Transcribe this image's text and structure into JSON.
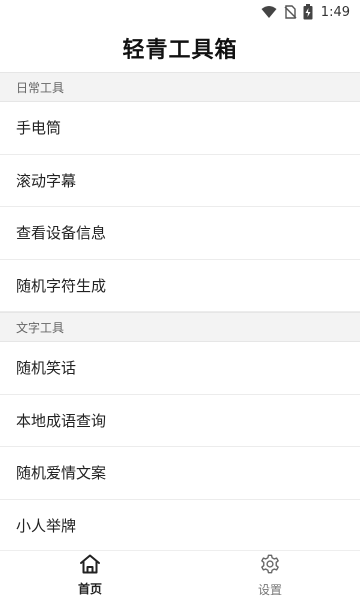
{
  "status_bar": {
    "time": "1:49",
    "icons": [
      "wifi-icon",
      "no-sim-icon",
      "battery-charging-icon"
    ]
  },
  "app_bar": {
    "title": "轻青工具箱"
  },
  "sections": [
    {
      "title": "日常工具",
      "items": [
        "手电筒",
        "滚动字幕",
        "查看设备信息",
        "随机字符生成"
      ]
    },
    {
      "title": "文字工具",
      "items": [
        "随机笑话",
        "本地成语查询",
        "随机爱情文案",
        "小人举牌"
      ]
    }
  ],
  "bottom_nav": {
    "home_label": "首页",
    "settings_label": "设置",
    "active": "home",
    "home_icon": "home-icon",
    "settings_icon": "gear-icon"
  },
  "colors": {
    "active": "#222222",
    "inactive": "#777777",
    "section_bg": "#f3f3f3"
  }
}
